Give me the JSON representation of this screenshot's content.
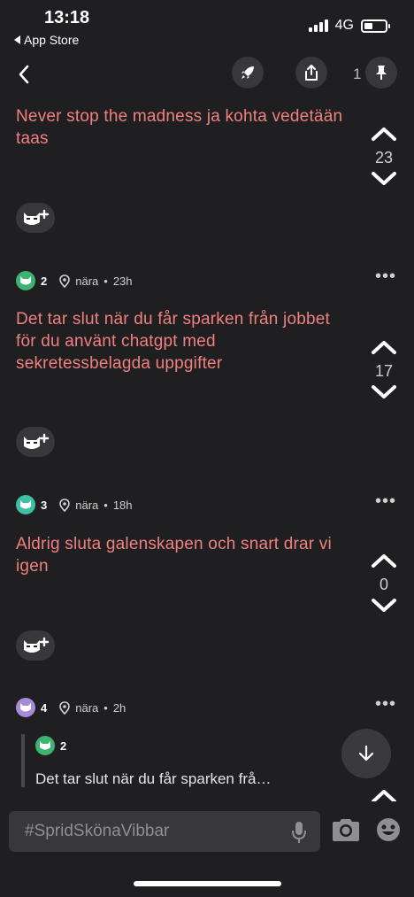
{
  "status_bar": {
    "time": "13:18",
    "back_label": "App Store",
    "network": "4G"
  },
  "nav": {
    "pinned_count": "1"
  },
  "posts": [
    {
      "text": "Never stop the madness ja kohta vedetään taas",
      "votes": "23"
    },
    {
      "author_num": "2",
      "location": "nära",
      "age": "23h",
      "text": "Det tar slut när du får sparken från jobbet för du använt chatgpt med sekretessbelagda uppgifter",
      "votes": "17",
      "avatar_color": "#3cb371"
    },
    {
      "author_num": "3",
      "location": "nära",
      "age": "18h",
      "text": "Aldrig sluta galenskapen och snart drar vi igen",
      "votes": "0",
      "avatar_color": "#3fbfa5"
    },
    {
      "author_num": "4",
      "location": "nära",
      "age": "2h",
      "avatar_color": "#a78bdb",
      "quote": {
        "author_num": "2",
        "text": "Det tar slut när du får sparken frå…"
      }
    }
  ],
  "composer": {
    "placeholder": "#SpridSkönaVibbar"
  },
  "icons": {
    "back": "chevron-left-icon",
    "boost": "rocket-icon",
    "share": "share-icon",
    "pin": "pin-icon",
    "react": "cat-plus-icon",
    "location": "location-pin-icon"
  }
}
